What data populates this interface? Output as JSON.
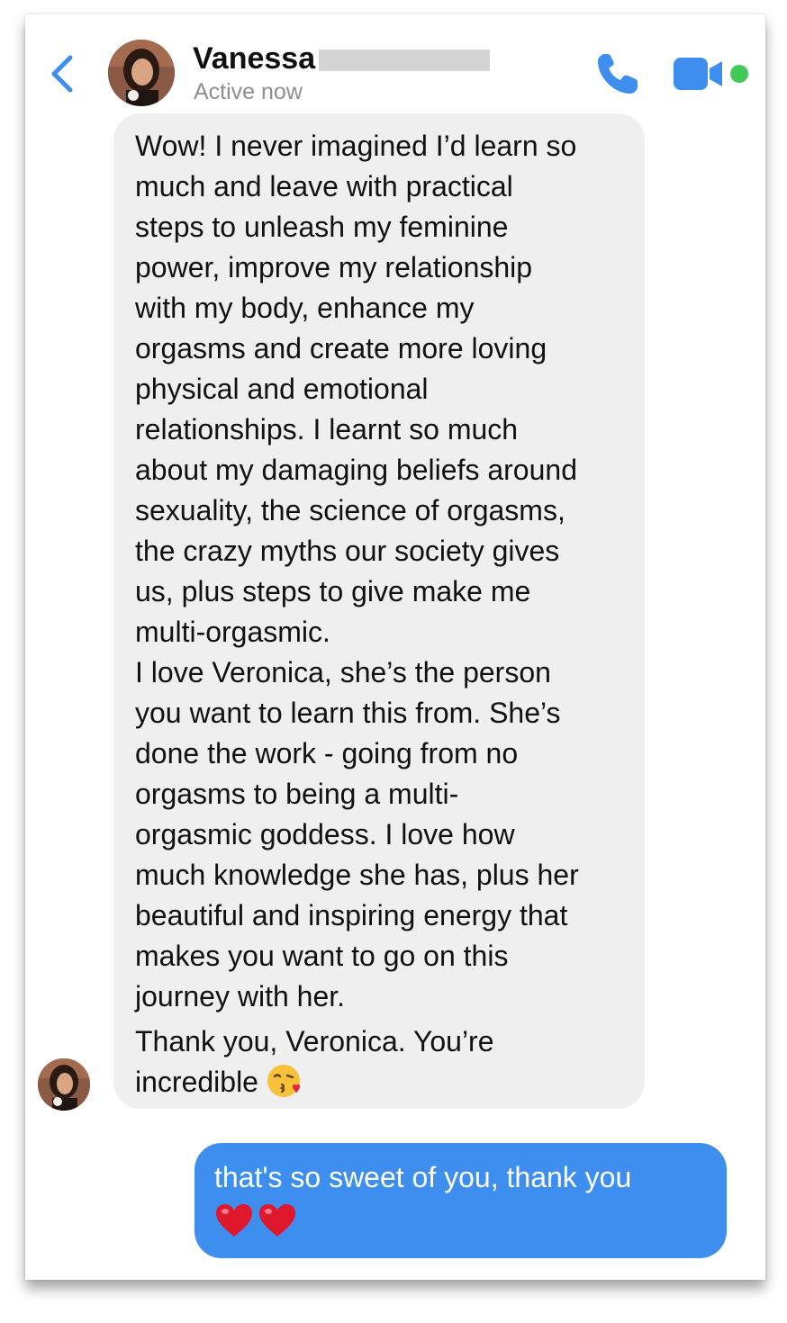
{
  "header": {
    "contact_name": "Vanessa",
    "status": "Active now"
  },
  "messages": {
    "received": {
      "paragraph_1": "Wow! I never imagined I’d learn so\nmuch and leave with practical\nsteps to unleash my feminine\npower, improve my relationship\nwith my body, enhance my\norgasms and create more loving\nphysical and emotional\nrelationships. I learnt so much\nabout my damaging beliefs around\nsexuality, the science of orgasms,\nthe crazy myths our society gives\nus, plus steps to give make me\nmulti-orgasmic.",
      "paragraph_2": "I love Veronica, she’s the person\nyou want to learn this from. She’s\ndone the work - going from no\norgasms to being a multi-\norgasmic goddess. I love how\nmuch knowledge she has, plus her\nbeautiful and inspiring energy that\nmakes you want to go on this\njourney with her.",
      "paragraph_3": "Thank you, Veronica. You’re\nincredible",
      "trailing_emoji": "kissing-face-with-heart-icon"
    },
    "sent": {
      "text": "that's so sweet of you, thank  you",
      "emojis": [
        "red-heart-icon",
        "red-heart-icon"
      ]
    }
  },
  "icons": {
    "back": "chevron-left-icon",
    "call": "phone-icon",
    "video": "video-camera-icon"
  },
  "colors": {
    "accent": "#3e8ef0",
    "received_bubble": "#efefef",
    "online": "#44c85a"
  }
}
